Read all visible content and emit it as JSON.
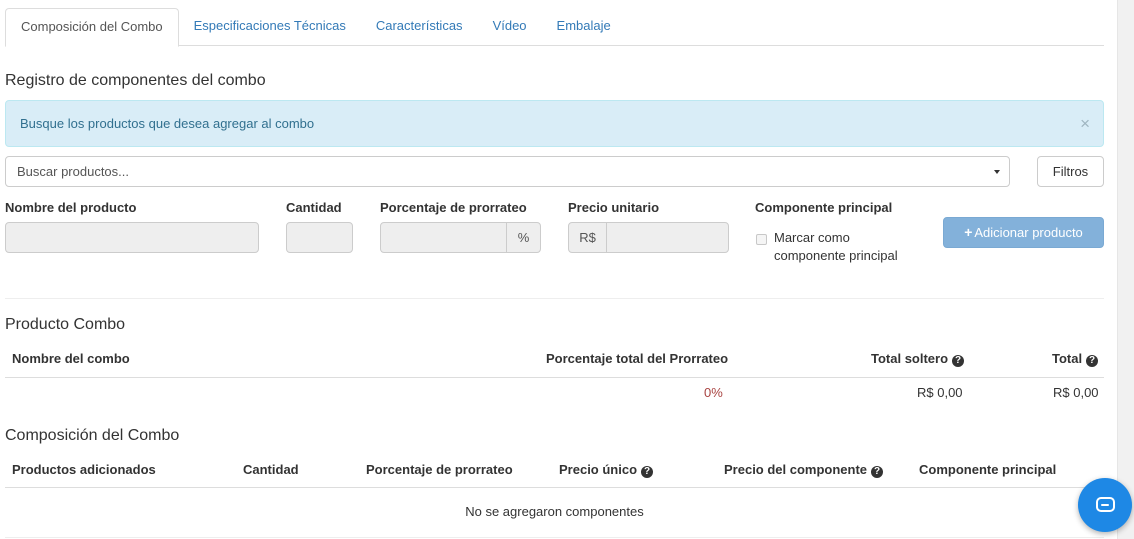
{
  "tabs": [
    {
      "label": "Composición del Combo",
      "active": true
    },
    {
      "label": "Especificaciones Técnicas"
    },
    {
      "label": "Características"
    },
    {
      "label": "Vídeo"
    },
    {
      "label": "Embalaje"
    }
  ],
  "register": {
    "title": "Registro de componentes del combo",
    "alert_text": "Busque los productos que desea agregar al combo",
    "alert_close": "×",
    "search_placeholder": "Buscar productos...",
    "filters_label": "Filtros",
    "fields": {
      "product_name_label": "Nombre del producto",
      "quantity_label": "Cantidad",
      "proration_label": "Porcentaje de prorrateo",
      "proration_addon": "%",
      "unit_price_label": "Precio unitario",
      "unit_price_addon": "R$",
      "main_component_label": "Componente principal",
      "main_component_checkbox": "Marcar como componente principal"
    },
    "add_button": "Adicionar producto"
  },
  "combo_product": {
    "title": "Producto Combo",
    "headers": {
      "name": "Nombre del combo",
      "proration_total": "Porcentaje total del Prorrateo",
      "total_single": "Total soltero",
      "total": "Total"
    },
    "row": {
      "name": "",
      "proration_total": "0%",
      "total_single": "R$ 0,00",
      "total": "R$ 0,00"
    }
  },
  "composition": {
    "title": "Composición del Combo",
    "headers": {
      "products": "Productos adicionados",
      "quantity": "Cantidad",
      "proration": "Porcentaje de prorrateo",
      "unit_price": "Precio único",
      "component_price": "Precio del componente",
      "main_component": "Componente principal"
    },
    "empty_text": "No se agregaron componentes"
  },
  "colors": {
    "link": "#337ab7",
    "alert_bg": "#d9edf7",
    "alert_text": "#31708f",
    "primary_button": "#83b1da",
    "percent_red": "#a94442",
    "chat": "#1e88e5"
  },
  "icons": {
    "help": "question-circle-icon",
    "add": "plus-icon",
    "chat": "chat-bubble-icon",
    "dropdown": "caret-down-icon",
    "close": "close-icon"
  }
}
